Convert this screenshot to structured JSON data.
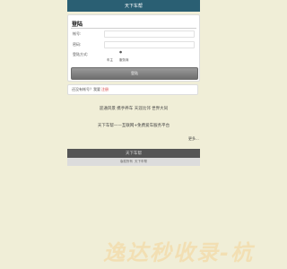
{
  "header": {
    "title": "天下车帮"
  },
  "login": {
    "title": "登陆",
    "account_label": "帐号:",
    "account_value": "",
    "password_label": "密码:",
    "password_value": "",
    "method_label": "登陆方式:",
    "method_dot": "●",
    "method_options": [
      "车主",
      "服务商"
    ],
    "submit_label": "登陆"
  },
  "register": {
    "prompt": "还没有帐号？我要",
    "link": "注册"
  },
  "content": {
    "slogan1": "迎通风景 携手养车 天涯比邻 世界大同",
    "slogan2": "天下车帮——互联网+免费爱车服务平台",
    "more": "更多..."
  },
  "footer": {
    "title": "天下车帮",
    "copy_prefix": "版权所有",
    "copy_site": "天下车帮"
  },
  "watermark": {
    "text": "逸达秒收录-杭"
  }
}
